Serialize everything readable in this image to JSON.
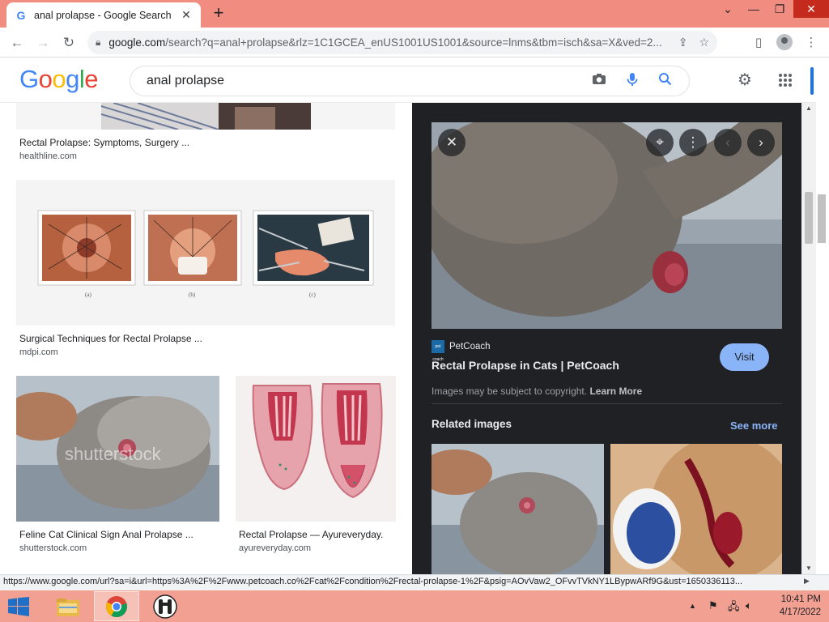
{
  "browser": {
    "tab_title": "anal prolapse - Google Search",
    "tab_favicon": "G",
    "url_host": "google.com",
    "url_path": "/search?q=anal+prolapse&rlz=1C1GCEA_enUS1001US1001&source=lnms&tbm=isch&sa=X&ved=2..."
  },
  "google": {
    "logo_letters": [
      "G",
      "o",
      "o",
      "g",
      "l",
      "e"
    ],
    "query": "anal prolapse"
  },
  "results": [
    {
      "caption": "Rectal Prolapse: Symptoms, Surgery ...",
      "source": "healthline.com"
    },
    {
      "caption": "Surgical Techniques for Rectal Prolapse ...",
      "source": "mdpi.com",
      "sublabels": [
        "(a)",
        "(b)",
        "(c)"
      ]
    },
    {
      "caption": "Feline Cat Clinical Sign Anal Prolapse ...",
      "source": "shutterstock.com",
      "watermark": "shutterstock"
    },
    {
      "caption": "Rectal Prolapse — Ayureveryday.",
      "source": "ayureveryday.com"
    }
  ],
  "preview": {
    "site_name": "PetCoach",
    "site_logo_text": "pet coach",
    "title": "Rectal Prolapse in Cats | PetCoach",
    "visit_label": "Visit",
    "copyright_text": "Images may be subject to copyright.",
    "learn_more": "Learn More",
    "related_heading": "Related images",
    "see_more": "See more"
  },
  "status_url": "https://www.google.com/url?sa=i&url=https%3A%2F%2Fwww.petcoach.co%2Fcat%2Fcondition%2Frectal-prolapse-1%2F&psig=AOvVaw2_OFvvTVkNY1LBypwARf9G&ust=1650336113...",
  "taskbar": {
    "time": "10:41 PM",
    "date": "4/17/2022"
  },
  "colors": {
    "titlebar": "#f08c80",
    "taskbar": "#f1a091",
    "panel": "#202124",
    "visit_button": "#8ab4f8",
    "google_blue": "#4285f4"
  }
}
